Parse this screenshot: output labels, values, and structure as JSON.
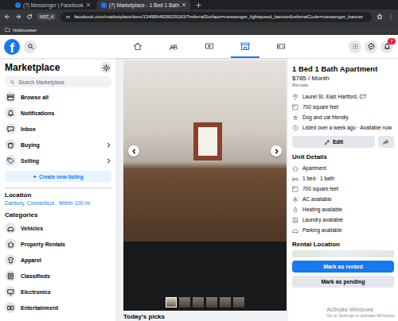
{
  "browser": {
    "tabs": [
      {
        "label": "(7) Messenger | Facebook",
        "selected": false
      },
      {
        "label": "(7) Marketplace - 1 Bed 1 Bath",
        "selected": true
      }
    ],
    "profile": "NST_4",
    "url": "facebook.com/marketplace/item/1349864926029163/?referralSurface=messenger_lightspeed_banner&referralCode=messenger_banner",
    "bookmarks": [
      "Nstbrowser"
    ]
  },
  "header": {
    "logo": "f",
    "nav": [
      {
        "selected": false
      },
      {
        "selected": false
      },
      {
        "selected": false
      },
      {
        "selected": true
      },
      {
        "selected": false
      }
    ],
    "notification_badge": "7"
  },
  "sidebar": {
    "title": "Marketplace",
    "search_placeholder": "Search Marketplace",
    "items": [
      {
        "label": "Browse all",
        "expandable": false,
        "selected": false
      },
      {
        "label": "Notifications",
        "expandable": false,
        "selected": false
      },
      {
        "label": "Inbox",
        "expandable": false,
        "selected": false
      },
      {
        "label": "Buying",
        "expandable": true,
        "selected": false
      },
      {
        "label": "Selling",
        "expandable": true,
        "selected": false
      }
    ],
    "create_button": {
      "icon": "+",
      "label": "Create new listing"
    },
    "location_heading": "Location",
    "location_value": "Danbury, Connecticut · Within 100 mi",
    "categories_heading": "Categories",
    "categories": [
      "Vehicles",
      "Property Rentals",
      "Apparel",
      "Classifieds",
      "Electronics",
      "Entertainment"
    ]
  },
  "viewer": {
    "thumbnails": [
      {
        "selected": true
      },
      {
        "selected": false
      },
      {
        "selected": false
      },
      {
        "selected": false
      },
      {
        "selected": false
      },
      {
        "selected": false
      }
    ]
  },
  "feed": {
    "heading": "Today's picks"
  },
  "listing": {
    "title": "1 Bed 1 Bath Apartment",
    "price": "$785 / Month",
    "category": "Rentals",
    "facts": [
      "Laurel St, East Hartford, CT",
      "700 square feet",
      "Dog and cat friendly",
      "Listed over a week ago · Available now"
    ],
    "edit_button": "Edit",
    "unit_details_heading": "Unit Details",
    "unit_details": [
      "Apartment",
      "1 bed · 1 bath",
      "700 square feet",
      "AC available",
      "Heating available",
      "Laundry available",
      "Parking available"
    ],
    "rental_location_heading": "Rental Location",
    "primary_button": "Mark as rented",
    "secondary_button": "Mark as pending"
  },
  "watermark": {
    "title": "Activate Windows",
    "subtitle": "Go to Settings to activate Windows."
  }
}
